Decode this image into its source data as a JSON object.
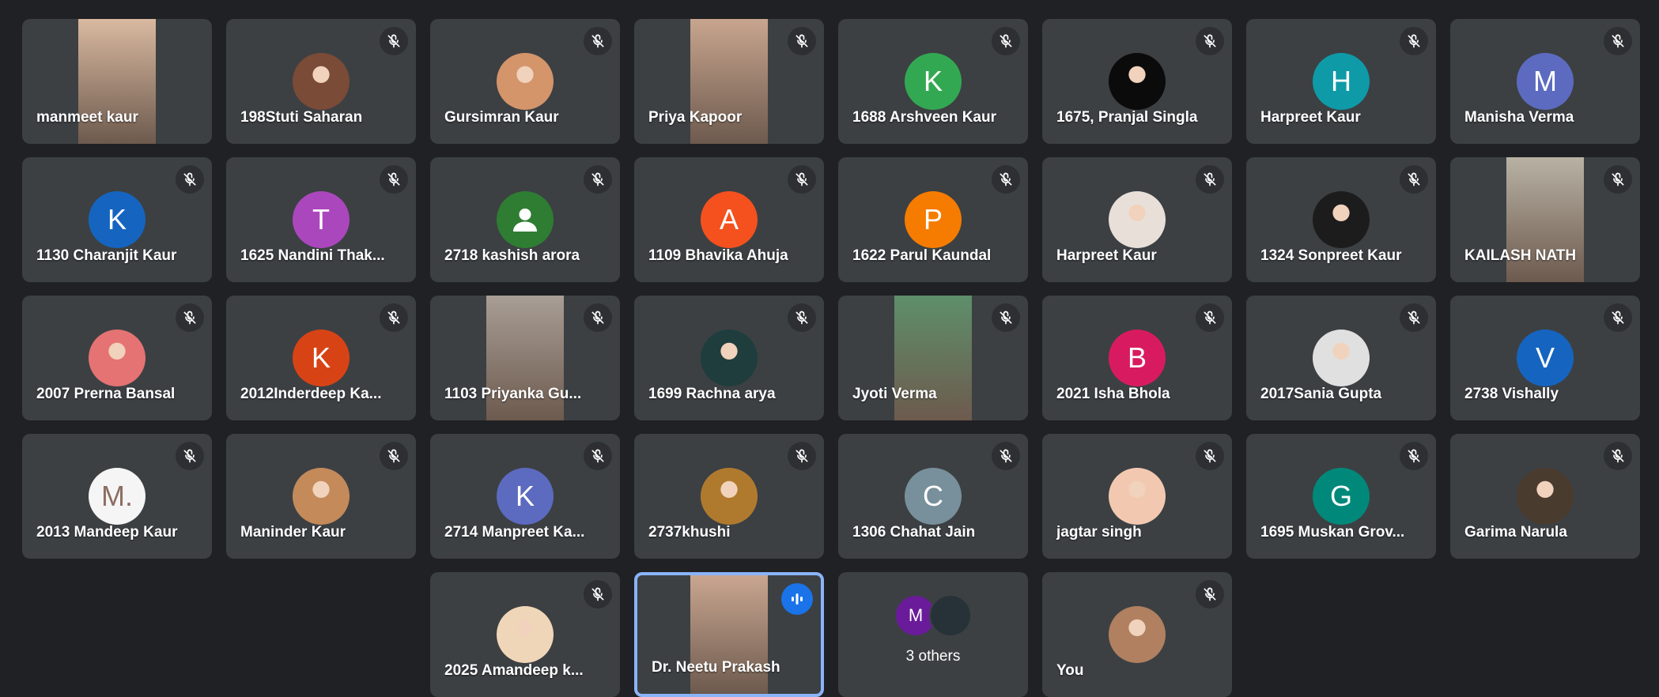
{
  "participants": [
    {
      "name": "manmeet kaur",
      "kind": "video",
      "bg": "#d9b9a0",
      "muted": false
    },
    {
      "name": "198Stuti Saharan",
      "kind": "photo",
      "bg": "#7a4b36",
      "muted": true
    },
    {
      "name": "Gursimran Kaur",
      "kind": "photo",
      "bg": "#d4956a",
      "muted": true
    },
    {
      "name": "Priya Kapoor",
      "kind": "video",
      "bg": "#c8a58e",
      "muted": true
    },
    {
      "name": "1688 Arshveen Kaur",
      "kind": "letter",
      "letter": "K",
      "bg": "#33a852",
      "muted": true
    },
    {
      "name": "1675, Pranjal Singla",
      "kind": "photo",
      "bg": "#0b0b0b",
      "muted": true
    },
    {
      "name": "Harpreet Kaur",
      "kind": "letter",
      "letter": "H",
      "bg": "#0f9aa8",
      "muted": true
    },
    {
      "name": "Manisha Verma",
      "kind": "letter",
      "letter": "M",
      "bg": "#5c6bc0",
      "muted": true
    },
    {
      "name": "1130 Charanjit Kaur",
      "kind": "letter",
      "letter": "K",
      "bg": "#1565c0",
      "muted": true
    },
    {
      "name": "1625 Nandini Thak...",
      "kind": "letter",
      "letter": "T",
      "bg": "#ab47bc",
      "muted": true
    },
    {
      "name": "2718 kashish arora",
      "kind": "person",
      "bg": "#2e7d32",
      "muted": true
    },
    {
      "name": "1109 Bhavika Ahuja",
      "kind": "letter",
      "letter": "A",
      "bg": "#f4511e",
      "muted": true
    },
    {
      "name": "1622 Parul Kaundal",
      "kind": "letter",
      "letter": "P",
      "bg": "#f57c00",
      "muted": true
    },
    {
      "name": "Harpreet Kaur",
      "kind": "photo",
      "bg": "#e8e0d8",
      "muted": true
    },
    {
      "name": "1324 Sonpreet Kaur",
      "kind": "photo",
      "bg": "#1c1c1c",
      "muted": true
    },
    {
      "name": "KAILASH NATH",
      "kind": "video",
      "bg": "#b8b2a4",
      "muted": true
    },
    {
      "name": "2007 Prerna Bansal",
      "kind": "photo",
      "bg": "#e57373",
      "muted": true
    },
    {
      "name": "2012Inderdeep Ka...",
      "kind": "letter",
      "letter": "K",
      "bg": "#d84315",
      "muted": true
    },
    {
      "name": "1103 Priyanka Gu...",
      "kind": "video",
      "bg": "#a89e95",
      "muted": true
    },
    {
      "name": "1699 Rachna arya",
      "kind": "photo",
      "bg": "#1f3d3d",
      "muted": true
    },
    {
      "name": "Jyoti Verma",
      "kind": "video",
      "bg": "#5e8f6a",
      "muted": true
    },
    {
      "name": "2021 Isha Bhola",
      "kind": "letter",
      "letter": "B",
      "bg": "#d81b60",
      "muted": true
    },
    {
      "name": "2017Sania Gupta",
      "kind": "photo",
      "bg": "#e0e0e0",
      "muted": true
    },
    {
      "name": "2738 Vishally",
      "kind": "letter",
      "letter": "V",
      "bg": "#1565c0",
      "muted": true
    },
    {
      "name": "2013 Mandeep Kaur",
      "kind": "letter",
      "letter": "M.",
      "bg": "#f5f5f5",
      "fg": "#8d6e63",
      "muted": true
    },
    {
      "name": "Maninder Kaur",
      "kind": "photo",
      "bg": "#c48a5a",
      "muted": true
    },
    {
      "name": "2714 Manpreet Ka...",
      "kind": "letter",
      "letter": "K",
      "bg": "#5c6bc0",
      "muted": true
    },
    {
      "name": "2737khushi",
      "kind": "photo",
      "bg": "#b07a2e",
      "muted": true
    },
    {
      "name": "1306 Chahat Jain",
      "kind": "letter",
      "letter": "C",
      "bg": "#78909c",
      "muted": true
    },
    {
      "name": "jagtar singh",
      "kind": "photo",
      "bg": "#f2c9b0",
      "muted": true
    },
    {
      "name": "1695 Muskan Grov...",
      "kind": "letter",
      "letter": "G",
      "bg": "#00897b",
      "muted": true
    },
    {
      "name": "Garima Narula",
      "kind": "photo",
      "bg": "#4a3b2f",
      "muted": true
    },
    {
      "name": "2025 Amandeep k...",
      "kind": "photo",
      "bg": "#f0d6b8",
      "muted": true
    },
    {
      "name": "Dr. Neetu Prakash",
      "kind": "video",
      "bg": "#c9a690",
      "muted": false,
      "speaking": true
    },
    {
      "name": "3 others",
      "kind": "others",
      "others_letter": "M",
      "others_bg1": "#6a1b9a",
      "others_bg2": "#263238",
      "muted": false
    },
    {
      "name": "You",
      "kind": "photo",
      "bg": "#b08060",
      "muted": true
    }
  ],
  "icons": {
    "mute": "mic-off-icon",
    "speaking": "audio-levels-icon"
  },
  "colors": {
    "background": "#202124",
    "tile": "#3c4043",
    "speaking_border": "#8ab4f8",
    "speaking_badge": "#1a73e8"
  }
}
